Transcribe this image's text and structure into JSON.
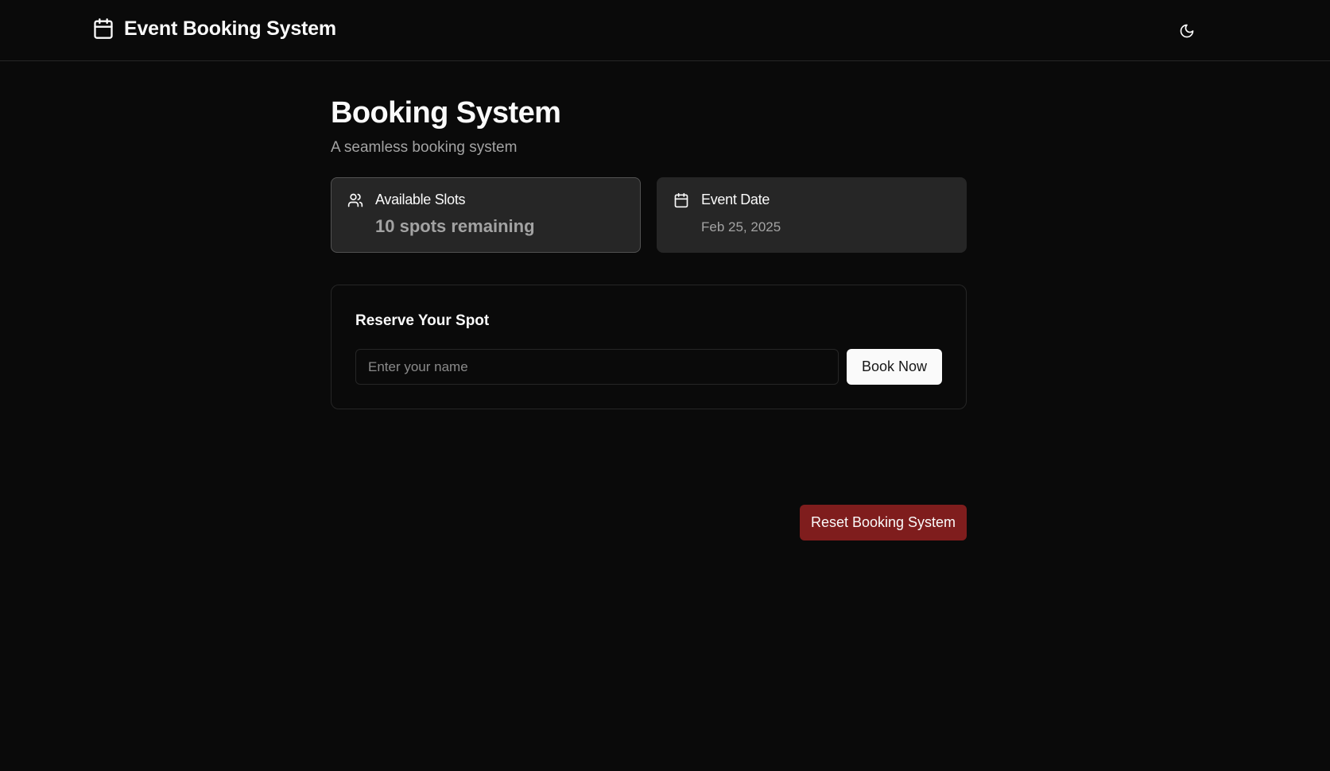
{
  "header": {
    "title": "Event Booking System",
    "brand_icon": "calendar-icon",
    "theme_toggle_icon": "moon-icon"
  },
  "main": {
    "title": "Booking System",
    "subtitle": "A seamless booking system"
  },
  "stats": {
    "slots": {
      "icon": "users-icon",
      "label": "Available Slots",
      "value": "10 spots remaining"
    },
    "date": {
      "icon": "calendar-icon",
      "label": "Event Date",
      "value": "Feb 25, 2025"
    }
  },
  "reserve": {
    "title": "Reserve Your Spot",
    "name_input": {
      "value": "",
      "placeholder": "Enter your name"
    },
    "book_label": "Book Now"
  },
  "reset_label": "Reset Booking System",
  "colors": {
    "background": "#0a0a0a",
    "card": "#262626",
    "border": "#262626",
    "text": "#fafafa",
    "muted_text": "#a3a3a3",
    "primary_button": "#fafafa",
    "danger_button": "#7f1d1d"
  }
}
